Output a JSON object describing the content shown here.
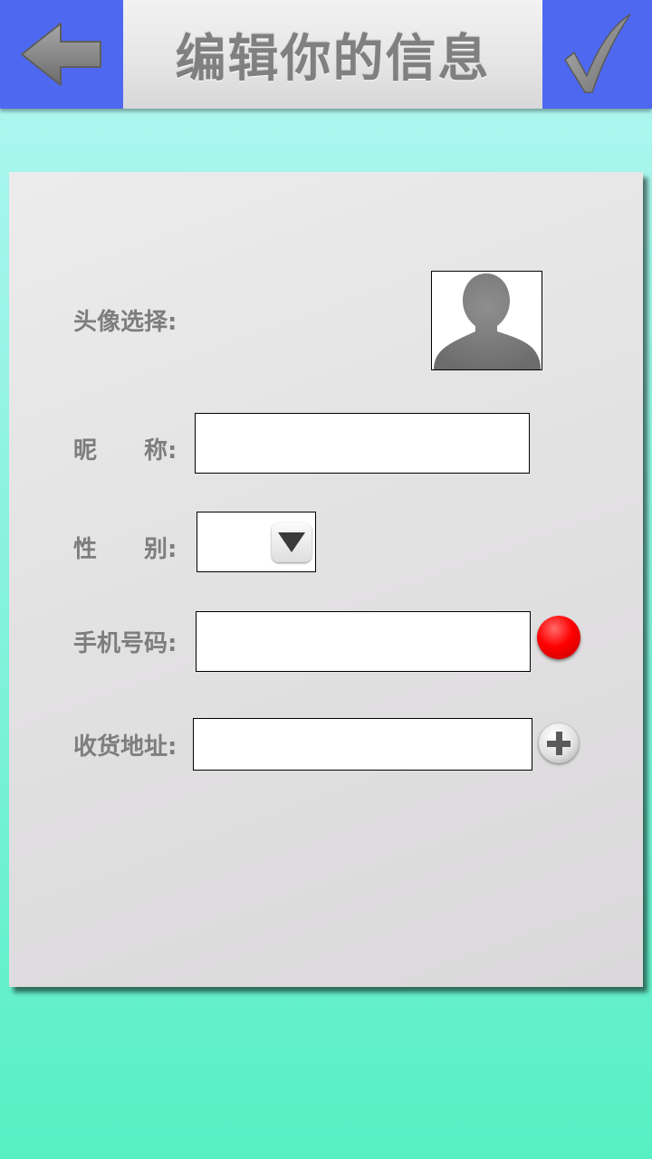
{
  "header": {
    "title": "编辑你的信息",
    "back_icon": "arrow-left-icon",
    "confirm_icon": "checkmark-icon"
  },
  "form": {
    "avatar": {
      "label": "头像选择:",
      "icon": "person-silhouette-icon"
    },
    "nickname": {
      "label": "昵　　称:",
      "value": ""
    },
    "gender": {
      "label": "性　　别:",
      "value": "",
      "icon": "triangle-down-icon"
    },
    "phone": {
      "label": "手机号码:",
      "value": "",
      "indicator_color": "#ff0000"
    },
    "address": {
      "label": "收货地址:",
      "value": "",
      "icon": "plus-icon"
    }
  },
  "colors": {
    "header_button_bg": "#4f68f0",
    "label_text": "#7d7d7d",
    "background_top": "#b3f7f2",
    "background_bottom": "#56f0c4"
  }
}
